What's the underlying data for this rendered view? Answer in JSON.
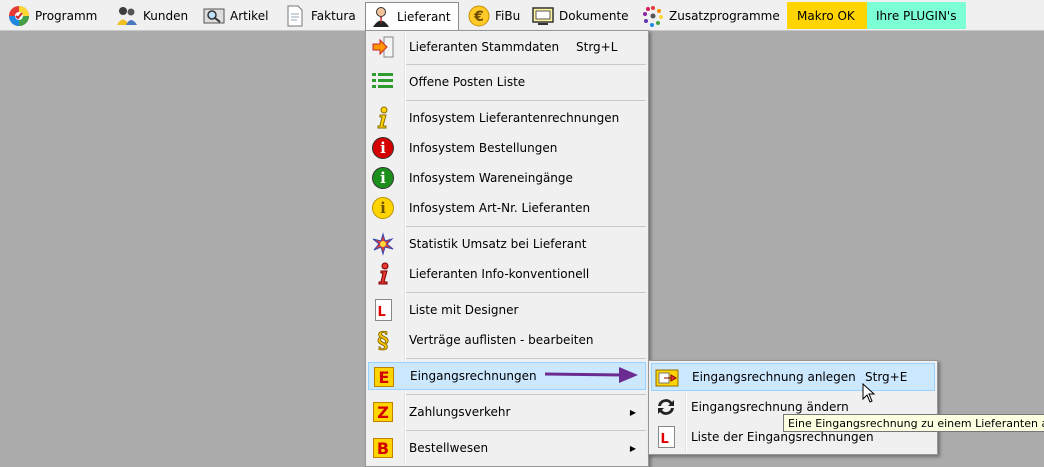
{
  "menubar": {
    "items": [
      {
        "label": "Programm",
        "icon": "colorful-circle-icon"
      },
      {
        "label": "Kunden",
        "icon": "people-icon"
      },
      {
        "label": "Artikel",
        "icon": "magnifier-box-icon"
      },
      {
        "label": "Faktura",
        "icon": "document-icon"
      },
      {
        "label": "Lieferant",
        "icon": "person-icon",
        "active": true
      },
      {
        "label": "FiBu",
        "icon": "euro-icon"
      },
      {
        "label": "Dokumente",
        "icon": "monitor-icon"
      },
      {
        "label": "Zusatzprogramme",
        "icon": "pinwheel-icon"
      }
    ],
    "makro_label": "Makro OK",
    "plugin_label": "Ihre PLUGIN's",
    "makro_color": "#ffd400",
    "plugin_color": "#7dffd6"
  },
  "lieferant_menu": {
    "items": [
      {
        "label": "Lieferanten Stammdaten",
        "shortcut": "Strg+L",
        "icon": "enter-arrow-icon"
      },
      {
        "label": "Offene Posten Liste",
        "icon": "green-list-icon"
      },
      {
        "label": "Infosystem Lieferantenrechnungen",
        "icon": "yellow-info-icon"
      },
      {
        "label": "Infosystem Bestellungen",
        "icon": "red-info-icon"
      },
      {
        "label": "Infosystem Wareneingänge",
        "icon": "green-info-icon"
      },
      {
        "label": "Infosystem Art-Nr. Lieferanten",
        "icon": "yellow-circle-info-icon"
      },
      {
        "label": "Statistik Umsatz bei Lieferant",
        "icon": "star-burst-icon"
      },
      {
        "label": "Lieferanten Info-konventionell",
        "icon": "red-info-figure-icon"
      },
      {
        "label": "Liste mit Designer",
        "icon": "list-document-icon"
      },
      {
        "label": "Verträge auflisten - bearbeiten",
        "icon": "paragraph-icon"
      },
      {
        "label": "Eingangsrechnungen",
        "icon": "letter-e-icon",
        "letter": "E",
        "submenu": true,
        "highlighted": true
      },
      {
        "label": "Zahlungsverkehr",
        "icon": "letter-z-icon",
        "letter": "Z",
        "submenu": true
      },
      {
        "label": "Bestellwesen",
        "icon": "letter-b-icon",
        "letter": "B",
        "submenu": true
      }
    ]
  },
  "eingangsrechnungen_submenu": {
    "items": [
      {
        "label": "Eingangsrechnung anlegen",
        "shortcut": "Strg+E",
        "icon": "invoice-add-icon",
        "highlighted": true
      },
      {
        "label": "Eingangsrechnung ändern",
        "icon": "refresh-icon"
      },
      {
        "label": "Liste der Eingangsrechnungen",
        "icon": "list-document-icon"
      }
    ]
  },
  "tooltip": {
    "text": "Eine Eingangsrechnung zu einem Lieferanten anlegen"
  },
  "colors": {
    "highlight": "#cce8ff",
    "highlight_border": "#99d1ff",
    "annotation_arrow": "#6a2c91",
    "desktop": "#ababab"
  }
}
